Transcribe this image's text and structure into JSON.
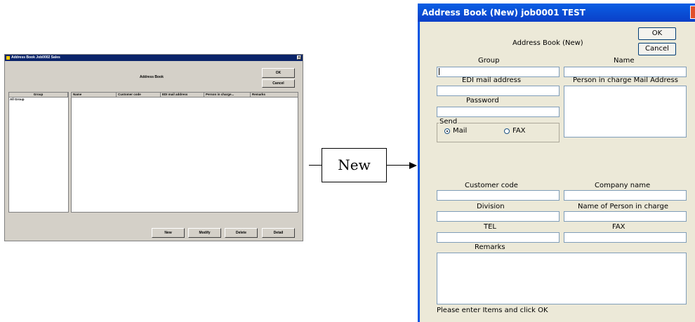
{
  "small_window": {
    "title": "Address Book Job0002 Sales",
    "close_glyph": "×",
    "heading": "Address Book",
    "ok_label": "OK",
    "cancel_label": "Cancel",
    "group_header": "Group",
    "group_items": [
      "All Group"
    ],
    "columns": [
      "Name",
      "Customer code",
      "EDI mail address",
      "Person in charge...",
      "Remarks"
    ],
    "buttons": {
      "new": "New",
      "modify": "Modify",
      "delete": "Delete",
      "detail": "Detail"
    }
  },
  "connector": {
    "label": "New"
  },
  "dialog": {
    "title": "Address Book (New) job0001 TEST",
    "heading": "Address Book (New)",
    "ok_label": "OK",
    "cancel_label": "Cancel",
    "labels": {
      "group": "Group",
      "name": "Name",
      "edi_mail": "EDI mail address",
      "person_mail": "Person in charge Mail Address",
      "password": "Password",
      "send": "Send",
      "mail": "Mail",
      "fax_option": "FAX",
      "customer_code": "Customer code",
      "company_name": "Company name",
      "division": "Division",
      "person_name": "Name of Person in charge",
      "tel": "TEL",
      "fax": "FAX",
      "remarks": "Remarks"
    },
    "send_selected": "Mail",
    "status": "Please enter Items and click OK",
    "colors": {
      "title_bar": "#0a5fe4",
      "face": "#ece9d8",
      "close": "#e0502a"
    }
  }
}
